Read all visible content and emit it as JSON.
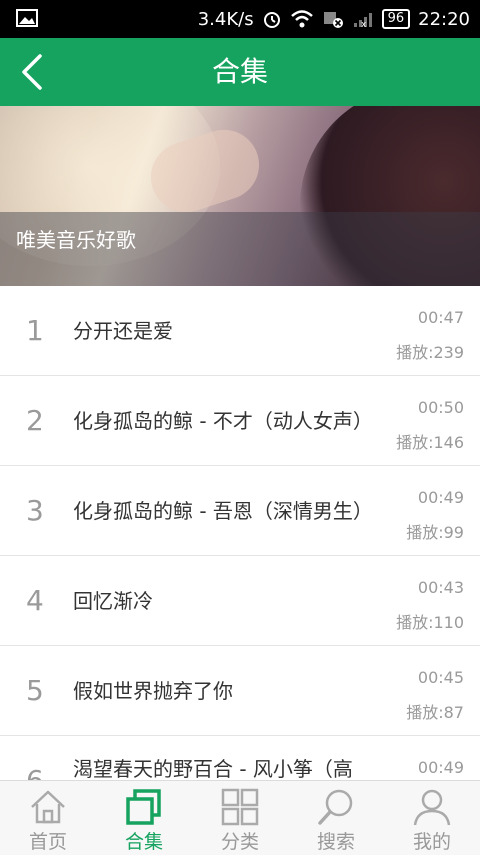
{
  "status_bar": {
    "network_speed": "3.4K/s",
    "battery": "96",
    "time": "22:20"
  },
  "header": {
    "title": "合集",
    "back_icon": "chevron-left-icon"
  },
  "banner": {
    "caption": "唯美音乐好歌"
  },
  "songs": [
    {
      "index": "1",
      "title": "分开还是爱",
      "duration": "00:47",
      "plays": "播放:239"
    },
    {
      "index": "2",
      "title": "化身孤岛的鲸 - 不才（动人女声）",
      "duration": "00:50",
      "plays": "播放:146"
    },
    {
      "index": "3",
      "title": "化身孤岛的鲸 - 吾恩（深情男生）",
      "duration": "00:49",
      "plays": "播放:99"
    },
    {
      "index": "4",
      "title": "回忆渐冷",
      "duration": "00:43",
      "plays": "播放:110"
    },
    {
      "index": "5",
      "title": "假如世界抛弃了你",
      "duration": "00:45",
      "plays": "播放:87"
    },
    {
      "index": "6",
      "title": "渴望春天的野百合 - 风小筝（高",
      "duration": "00:49",
      "plays": ""
    }
  ],
  "bottom_nav": [
    {
      "label": "首页",
      "icon": "home-icon"
    },
    {
      "label": "合集",
      "icon": "collection-icon",
      "active": true
    },
    {
      "label": "分类",
      "icon": "grid-icon"
    },
    {
      "label": "搜索",
      "icon": "search-icon"
    },
    {
      "label": "我的",
      "icon": "user-icon"
    }
  ],
  "colors": {
    "primary": "#16a35f",
    "text_secondary": "#9a9a9a"
  }
}
